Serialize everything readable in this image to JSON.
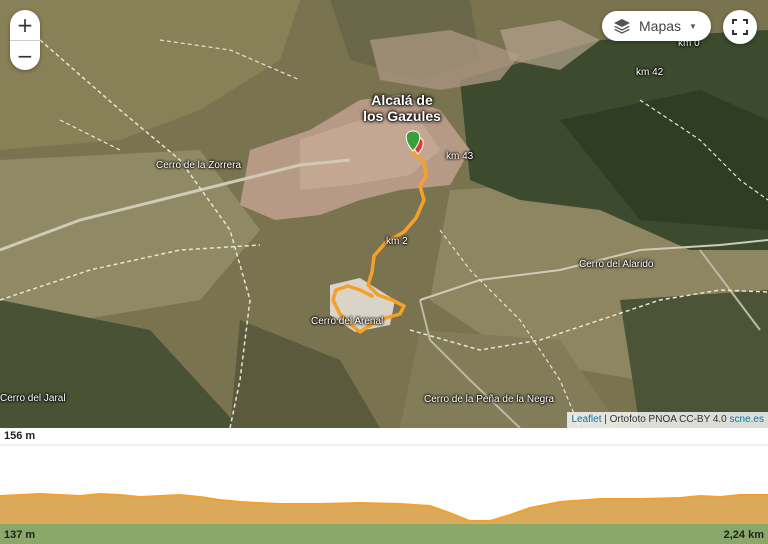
{
  "map": {
    "zoom_in_label": "+",
    "zoom_out_label": "−",
    "layers_label": "Mapas",
    "attribution": {
      "leaflet": "Leaflet",
      "separator": " | Ortofoto PNOA CC-BY 4.0 ",
      "source": "scne.es"
    },
    "labels": {
      "town": "Alcalá de los Gazules",
      "cerro_zorrera": "Cerro de la Zorrera",
      "cerro_alarido": "Cerro del Alarido",
      "cerro_arenal": "Cerro del Arenal",
      "cerro_jaral": "Cerro del Jaral",
      "cerro_pena_negra": "Cerro de la Peña de la Negra",
      "km0": "km 0",
      "km42": "km 42",
      "km43": "km 43",
      "km2": "km 2"
    }
  },
  "profile": {
    "max_elevation": "156 m",
    "min_elevation": "137 m",
    "distance": "2,24 km"
  },
  "colors": {
    "route": "#f5a02a",
    "start_marker": "#3a9e3a",
    "end_marker": "#e53935",
    "profile_fill": "#dba95a",
    "profile_base": "#8aa86a"
  }
}
